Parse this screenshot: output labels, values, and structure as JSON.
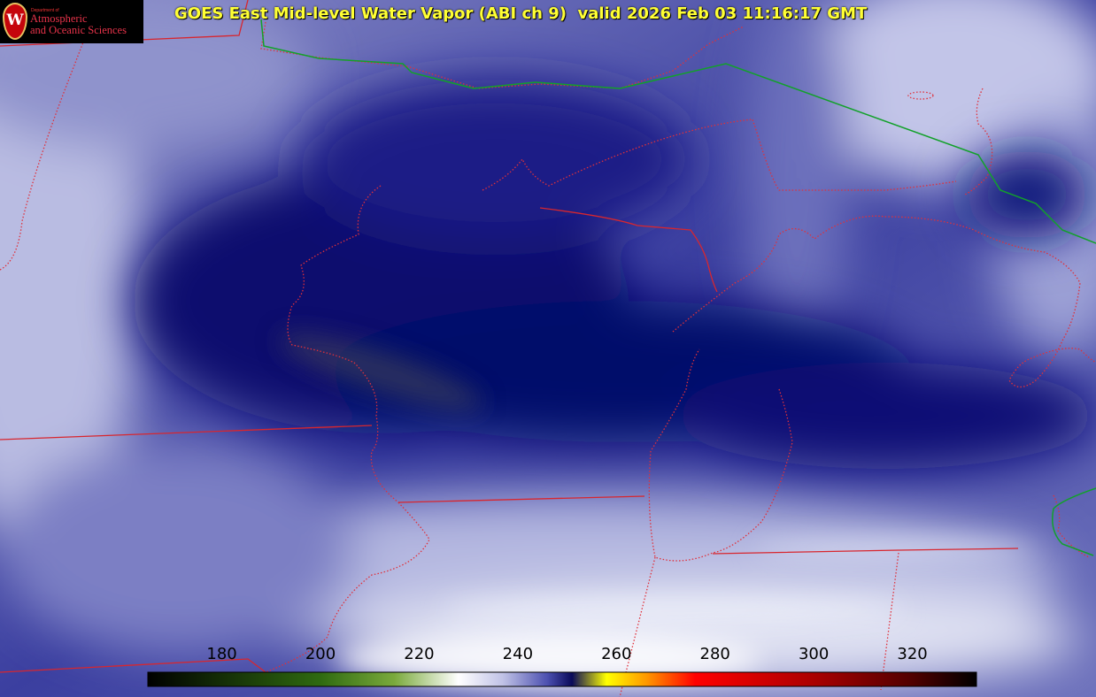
{
  "title": "GOES East Mid-level Water Vapor (ABI ch 9)  valid 2026 Feb 03 11:16:17 GMT",
  "logo": {
    "dept": "Department of",
    "line1": "Atmospheric",
    "line2": "and Oceanic Sciences",
    "mark": "W"
  },
  "colorbar": {
    "min": 165,
    "max": 333,
    "ticks": [
      "180",
      "200",
      "220",
      "240",
      "260",
      "280",
      "300",
      "320"
    ],
    "stops": [
      {
        "value": 165,
        "color": "#000000"
      },
      {
        "value": 200,
        "color": "#2f6a10"
      },
      {
        "value": 215,
        "color": "#7aaa3c"
      },
      {
        "value": 228,
        "color": "#ffffff"
      },
      {
        "value": 237,
        "color": "#c0c2e6"
      },
      {
        "value": 246,
        "color": "#4c50b0"
      },
      {
        "value": 251,
        "color": "#0a0a5a"
      },
      {
        "value": 258,
        "color": "#ffff00"
      },
      {
        "value": 266,
        "color": "#ff9900"
      },
      {
        "value": 276,
        "color": "#ff0000"
      },
      {
        "value": 300,
        "color": "#aa0000"
      },
      {
        "value": 320,
        "color": "#500000"
      },
      {
        "value": 333,
        "color": "#000000"
      }
    ]
  },
  "colors": {
    "state_borders": "#e0303a",
    "country_border": "#18a018",
    "title": "#ffff33",
    "dry": "#0a0a78",
    "moist": "#d8dcf0"
  }
}
